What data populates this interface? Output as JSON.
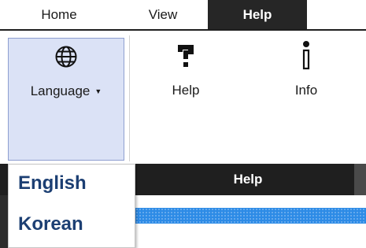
{
  "tabs": [
    {
      "label": "Home"
    },
    {
      "label": "View"
    },
    {
      "label": "Help",
      "active": true
    }
  ],
  "ribbon": {
    "language": {
      "label": "Language",
      "icon": "globe-icon"
    },
    "help": {
      "label": "Help",
      "icon": "question-icon"
    },
    "info": {
      "label": "Info",
      "icon": "info-icon"
    }
  },
  "panel": {
    "header_title": "Help"
  },
  "dropdown": {
    "items": [
      {
        "label": "English"
      },
      {
        "label": "Korean"
      }
    ]
  },
  "colors": {
    "active_tab_bg": "#262626",
    "language_button_bg": "#dbe2f6",
    "dropdown_text": "#1c3f73",
    "blue_bar": "#2d8be6"
  }
}
